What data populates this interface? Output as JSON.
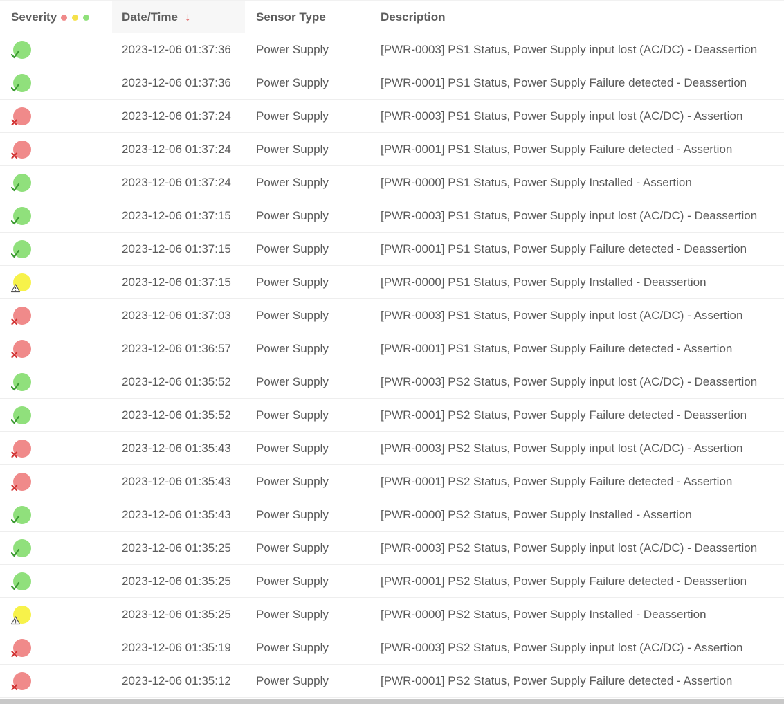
{
  "columns": {
    "severity": "Severity",
    "datetime": "Date/Time",
    "sort_indicator": "↓",
    "sensor_type": "Sensor Type",
    "description": "Description"
  },
  "severity_legend": {
    "critical_color": "#f08a8a",
    "warning_color": "#f5e14a",
    "ok_color": "#8fe07a"
  },
  "severity_styles": {
    "ok": {
      "icon": "ok-check-icon",
      "fill": "#90e07c",
      "mark": "#3c9a32"
    },
    "critical": {
      "icon": "critical-x-icon",
      "fill": "#f08a8a",
      "mark": "#d23333"
    },
    "warning": {
      "icon": "warning-triangle-icon",
      "fill": "#f7f24a",
      "mark": "#555555"
    }
  },
  "rows": [
    {
      "severity": "ok",
      "datetime": "2023-12-06 01:37:36",
      "sensor_type": "Power Supply",
      "description": "[PWR-0003] PS1 Status, Power Supply input lost (AC/DC) - Deassertion"
    },
    {
      "severity": "ok",
      "datetime": "2023-12-06 01:37:36",
      "sensor_type": "Power Supply",
      "description": "[PWR-0001] PS1 Status, Power Supply Failure detected - Deassertion"
    },
    {
      "severity": "critical",
      "datetime": "2023-12-06 01:37:24",
      "sensor_type": "Power Supply",
      "description": "[PWR-0003] PS1 Status, Power Supply input lost (AC/DC) - Assertion"
    },
    {
      "severity": "critical",
      "datetime": "2023-12-06 01:37:24",
      "sensor_type": "Power Supply",
      "description": "[PWR-0001] PS1 Status, Power Supply Failure detected - Assertion"
    },
    {
      "severity": "ok",
      "datetime": "2023-12-06 01:37:24",
      "sensor_type": "Power Supply",
      "description": "[PWR-0000] PS1 Status, Power Supply Installed - Assertion"
    },
    {
      "severity": "ok",
      "datetime": "2023-12-06 01:37:15",
      "sensor_type": "Power Supply",
      "description": "[PWR-0003] PS1 Status, Power Supply input lost (AC/DC) - Deassertion"
    },
    {
      "severity": "ok",
      "datetime": "2023-12-06 01:37:15",
      "sensor_type": "Power Supply",
      "description": "[PWR-0001] PS1 Status, Power Supply Failure detected - Deassertion"
    },
    {
      "severity": "warning",
      "datetime": "2023-12-06 01:37:15",
      "sensor_type": "Power Supply",
      "description": "[PWR-0000] PS1 Status, Power Supply Installed - Deassertion"
    },
    {
      "severity": "critical",
      "datetime": "2023-12-06 01:37:03",
      "sensor_type": "Power Supply",
      "description": "[PWR-0003] PS1 Status, Power Supply input lost (AC/DC) - Assertion"
    },
    {
      "severity": "critical",
      "datetime": "2023-12-06 01:36:57",
      "sensor_type": "Power Supply",
      "description": "[PWR-0001] PS1 Status, Power Supply Failure detected - Assertion"
    },
    {
      "severity": "ok",
      "datetime": "2023-12-06 01:35:52",
      "sensor_type": "Power Supply",
      "description": "[PWR-0003] PS2 Status, Power Supply input lost (AC/DC) - Deassertion"
    },
    {
      "severity": "ok",
      "datetime": "2023-12-06 01:35:52",
      "sensor_type": "Power Supply",
      "description": "[PWR-0001] PS2 Status, Power Supply Failure detected - Deassertion"
    },
    {
      "severity": "critical",
      "datetime": "2023-12-06 01:35:43",
      "sensor_type": "Power Supply",
      "description": "[PWR-0003] PS2 Status, Power Supply input lost (AC/DC) - Assertion"
    },
    {
      "severity": "critical",
      "datetime": "2023-12-06 01:35:43",
      "sensor_type": "Power Supply",
      "description": "[PWR-0001] PS2 Status, Power Supply Failure detected - Assertion"
    },
    {
      "severity": "ok",
      "datetime": "2023-12-06 01:35:43",
      "sensor_type": "Power Supply",
      "description": "[PWR-0000] PS2 Status, Power Supply Installed - Assertion"
    },
    {
      "severity": "ok",
      "datetime": "2023-12-06 01:35:25",
      "sensor_type": "Power Supply",
      "description": "[PWR-0003] PS2 Status, Power Supply input lost (AC/DC) - Deassertion"
    },
    {
      "severity": "ok",
      "datetime": "2023-12-06 01:35:25",
      "sensor_type": "Power Supply",
      "description": "[PWR-0001] PS2 Status, Power Supply Failure detected - Deassertion"
    },
    {
      "severity": "warning",
      "datetime": "2023-12-06 01:35:25",
      "sensor_type": "Power Supply",
      "description": "[PWR-0000] PS2 Status, Power Supply Installed - Deassertion"
    },
    {
      "severity": "critical",
      "datetime": "2023-12-06 01:35:19",
      "sensor_type": "Power Supply",
      "description": "[PWR-0003] PS2 Status, Power Supply input lost (AC/DC) - Assertion"
    },
    {
      "severity": "critical",
      "datetime": "2023-12-06 01:35:12",
      "sensor_type": "Power Supply",
      "description": "[PWR-0001] PS2 Status, Power Supply Failure detected - Assertion"
    }
  ]
}
